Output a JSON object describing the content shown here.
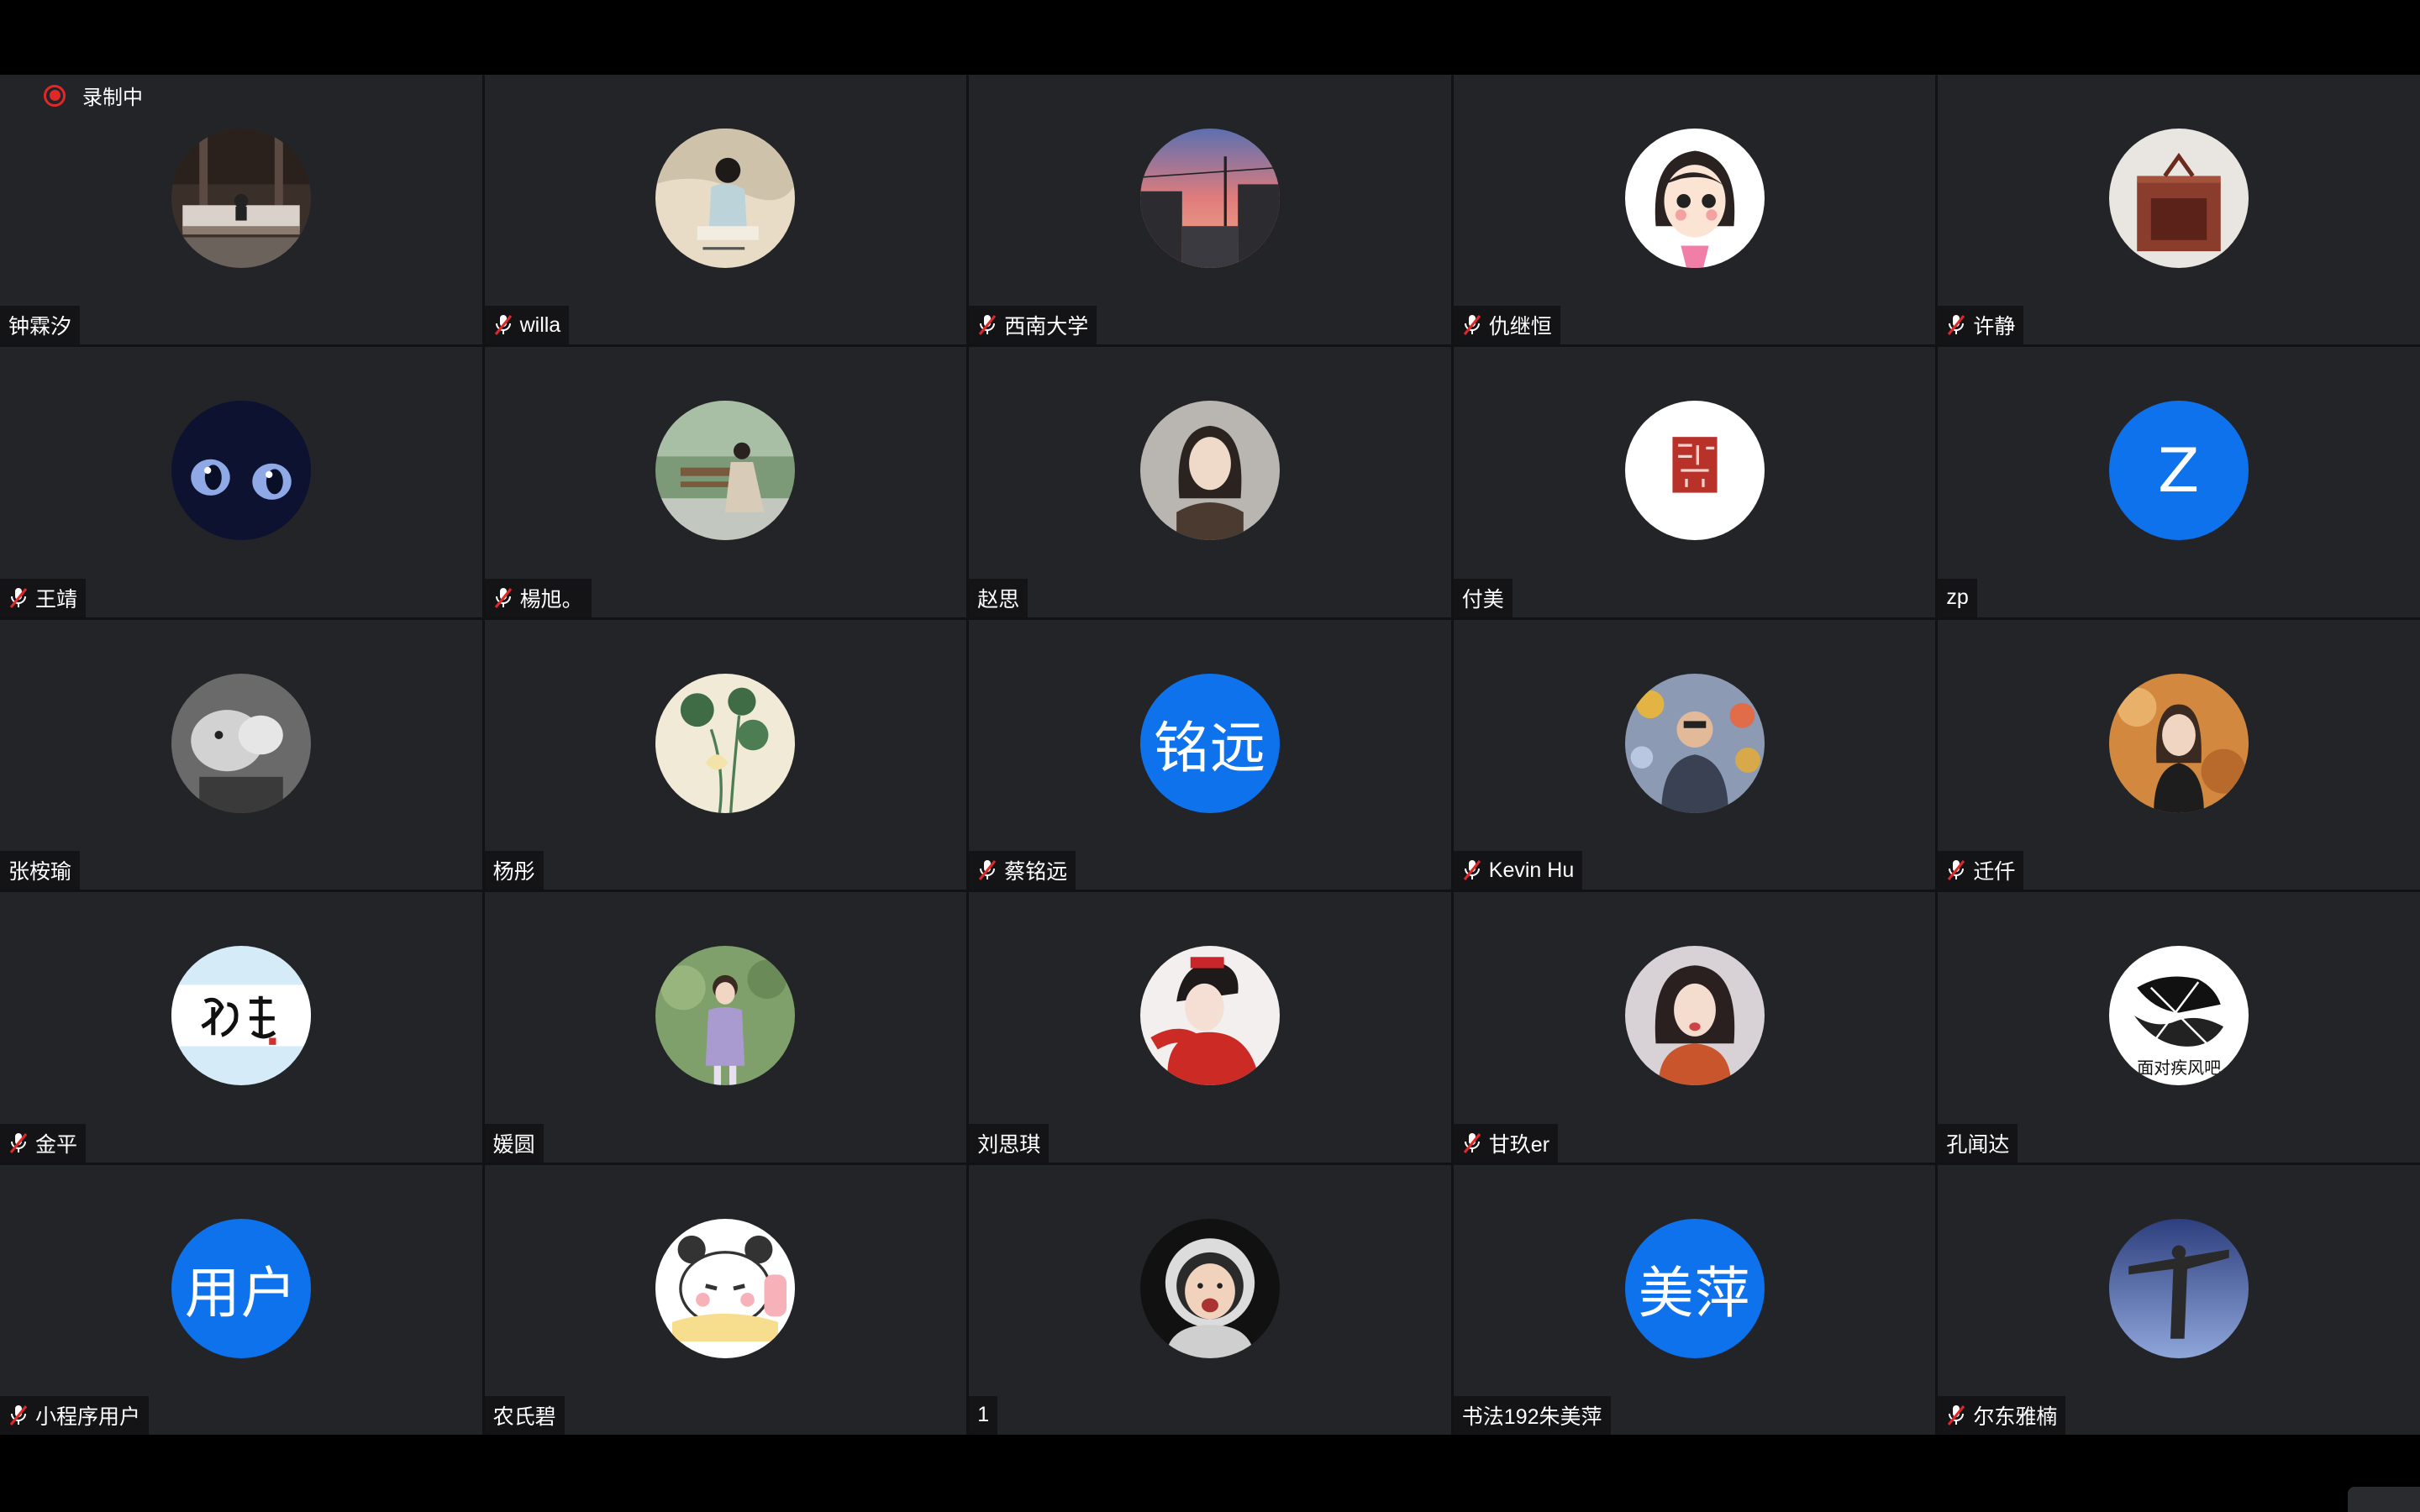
{
  "recording": {
    "label": "录制中"
  },
  "colors": {
    "avatar_default": "#0e72ed",
    "tile_bg": "#232427",
    "recording_red": "#e02828",
    "mic_muted_red": "#e02828"
  },
  "participants": [
    {
      "name": "钟霖汐",
      "muted": false,
      "avatar": "photo-room"
    },
    {
      "name": "willa",
      "muted": true,
      "avatar": "photo-woman-painting"
    },
    {
      "name": "西南大学",
      "muted": true,
      "avatar": "photo-sunset-street"
    },
    {
      "name": "仇继恒",
      "muted": true,
      "avatar": "cartoon-girl"
    },
    {
      "name": "许静",
      "muted": true,
      "avatar": "photo-furniture"
    },
    {
      "name": "王靖",
      "muted": true,
      "avatar": "cat-eyes"
    },
    {
      "name": "楊旭。",
      "muted": true,
      "avatar": "photo-bench"
    },
    {
      "name": "赵思",
      "muted": false,
      "avatar": "photo-woman"
    },
    {
      "name": "付美",
      "muted": false,
      "avatar": "red-seal"
    },
    {
      "name": "zp",
      "muted": false,
      "avatar_text": "Z"
    },
    {
      "name": "张桉瑜",
      "muted": false,
      "avatar": "photo-bw-sheep"
    },
    {
      "name": "杨彤",
      "muted": false,
      "avatar": "lotus-painting"
    },
    {
      "name": "蔡铭远",
      "muted": true,
      "avatar_text": "铭远"
    },
    {
      "name": "Kevin Hu",
      "muted": true,
      "avatar": "photo-man-flowers"
    },
    {
      "name": "迁仟",
      "muted": true,
      "avatar": "photo-woman-autumn"
    },
    {
      "name": "金平",
      "muted": true,
      "avatar": "calligraphy-snow"
    },
    {
      "name": "媛圆",
      "muted": false,
      "avatar": "photo-girl-purple"
    },
    {
      "name": "刘思琪",
      "muted": false,
      "avatar": "photo-woman-red"
    },
    {
      "name": "甘玖er",
      "muted": true,
      "avatar": "photo-woman-orange"
    },
    {
      "name": "孔闻达",
      "muted": false,
      "avatar": "ink-sketch",
      "avatar_caption": "面对疾风吧"
    },
    {
      "name": "小程序用户",
      "muted": true,
      "avatar_text": "用户"
    },
    {
      "name": "农氏碧",
      "muted": false,
      "avatar": "cartoon-bear"
    },
    {
      "name": "1",
      "muted": false,
      "avatar": "photo-baby-astronaut"
    },
    {
      "name": "书法192朱美萍",
      "muted": false,
      "avatar_text": "美萍"
    },
    {
      "name": "尔东雅楠",
      "muted": true,
      "avatar": "photo-statue"
    }
  ]
}
